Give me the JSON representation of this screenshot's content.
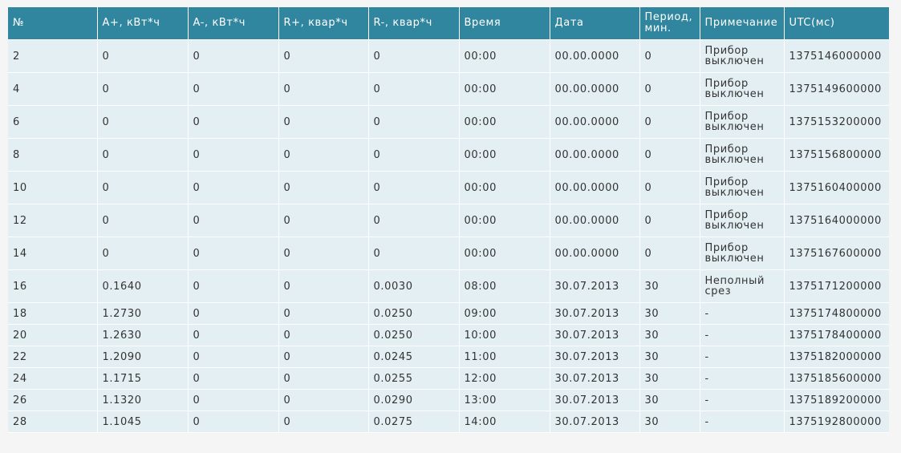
{
  "table": {
    "headers": [
      "№",
      "A+, кВт*ч",
      "A-, кВт*ч",
      "R+, квар*ч",
      "R-, квар*ч",
      "Время",
      "Дата",
      "Период, мин.",
      "Примечание",
      "UTC(мс)"
    ],
    "rows": [
      [
        "2",
        "0",
        "0",
        "0",
        "0",
        "00:00",
        "00.00.0000",
        "0",
        "Прибор выключен",
        "1375146000000"
      ],
      [
        "4",
        "0",
        "0",
        "0",
        "0",
        "00:00",
        "00.00.0000",
        "0",
        "Прибор выключен",
        "1375149600000"
      ],
      [
        "6",
        "0",
        "0",
        "0",
        "0",
        "00:00",
        "00.00.0000",
        "0",
        "Прибор выключен",
        "1375153200000"
      ],
      [
        "8",
        "0",
        "0",
        "0",
        "0",
        "00:00",
        "00.00.0000",
        "0",
        "Прибор выключен",
        "1375156800000"
      ],
      [
        "10",
        "0",
        "0",
        "0",
        "0",
        "00:00",
        "00.00.0000",
        "0",
        "Прибор выключен",
        "1375160400000"
      ],
      [
        "12",
        "0",
        "0",
        "0",
        "0",
        "00:00",
        "00.00.0000",
        "0",
        "Прибор выключен",
        "1375164000000"
      ],
      [
        "14",
        "0",
        "0",
        "0",
        "0",
        "00:00",
        "00.00.0000",
        "0",
        "Прибор выключен",
        "1375167600000"
      ],
      [
        "16",
        "0.1640",
        "0",
        "0",
        "0.0030",
        "08:00",
        "30.07.2013",
        "30",
        "Неполный срез",
        "1375171200000"
      ],
      [
        "18",
        "1.2730",
        "0",
        "0",
        "0.0250",
        "09:00",
        "30.07.2013",
        "30",
        "-",
        "1375174800000"
      ],
      [
        "20",
        "1.2630",
        "0",
        "0",
        "0.0250",
        "10:00",
        "30.07.2013",
        "30",
        "-",
        "1375178400000"
      ],
      [
        "22",
        "1.2090",
        "0",
        "0",
        "0.0245",
        "11:00",
        "30.07.2013",
        "30",
        "-",
        "1375182000000"
      ],
      [
        "24",
        "1.1715",
        "0",
        "0",
        "0.0255",
        "12:00",
        "30.07.2013",
        "30",
        "-",
        "1375185600000"
      ],
      [
        "26",
        "1.1320",
        "0",
        "0",
        "0.0290",
        "13:00",
        "30.07.2013",
        "30",
        "-",
        "1375189200000"
      ],
      [
        "28",
        "1.1045",
        "0",
        "0",
        "0.0275",
        "14:00",
        "30.07.2013",
        "30",
        "-",
        "1375192800000"
      ]
    ]
  },
  "colors": {
    "header_bg": "#31869f",
    "row_bg": "#e4eff3",
    "page_bg": "#f5f5f5"
  }
}
